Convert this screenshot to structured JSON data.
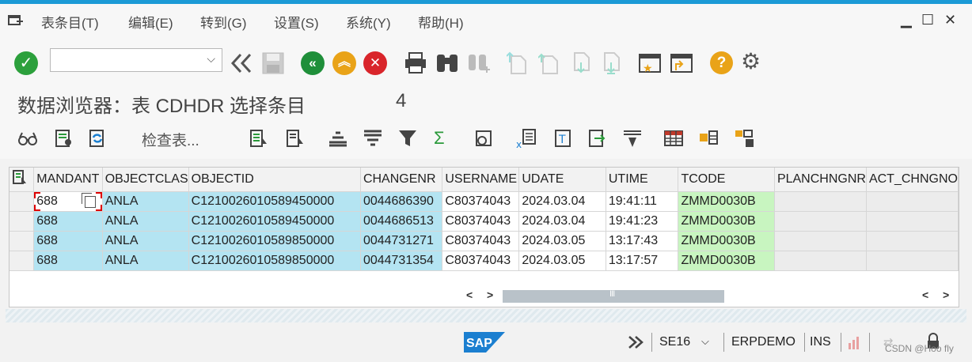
{
  "menubar": {
    "items": [
      "表条目(T)",
      "编辑(E)",
      "转到(G)",
      "设置(S)",
      "系统(Y)",
      "帮助(H)"
    ],
    "window_controls": [
      "▁",
      "☐",
      "✕"
    ]
  },
  "toolbar": {
    "command_field": {
      "value": "",
      "placeholder": ""
    },
    "icons": [
      "enter-icon",
      "back-double-icon",
      "save-icon",
      "back-icon",
      "exit-icon",
      "cancel-icon",
      "print-icon",
      "find-icon",
      "find-next-icon",
      "first-page-icon",
      "prev-page-icon",
      "next-page-icon",
      "last-page-icon",
      "create-session-icon",
      "shortcut-icon",
      "help-icon",
      "settings-icon"
    ]
  },
  "title": {
    "text": "数据浏览器：表 CDHDR 选择条目",
    "count": "4"
  },
  "apptoolbar": {
    "check_table": "检查表..."
  },
  "grid": {
    "columns": [
      "MANDANT",
      "OBJECTCLAS",
      "OBJECTID",
      "CHANGENR",
      "USERNAME",
      "UDATE",
      "UTIME",
      "TCODE",
      "PLANCHNGNR",
      "ACT_CHNGNO"
    ],
    "rows": [
      {
        "mandant": "688",
        "objectclas": "ANLA",
        "objectid": "C1210026010589450000",
        "changenr": "0044686390",
        "username": "C80374043",
        "udate": "2024.03.04",
        "utime": "19:41:11",
        "tcode": "ZMMD0030B"
      },
      {
        "mandant": "688",
        "objectclas": "ANLA",
        "objectid": "C1210026010589450000",
        "changenr": "0044686513",
        "username": "C80374043",
        "udate": "2024.03.04",
        "utime": "19:41:23",
        "tcode": "ZMMD0030B"
      },
      {
        "mandant": "688",
        "objectclas": "ANLA",
        "objectid": "C1210026010589850000",
        "changenr": "0044731271",
        "username": "C80374043",
        "udate": "2024.03.05",
        "utime": "13:17:43",
        "tcode": "ZMMD0030B"
      },
      {
        "mandant": "688",
        "objectclas": "ANLA",
        "objectid": "C1210026010589850000",
        "changenr": "0044731354",
        "username": "C80374043",
        "udate": "2024.03.05",
        "utime": "13:17:57",
        "tcode": "ZMMD0030B"
      }
    ],
    "scroll": {
      "left": "<",
      "right": ">",
      "grip": "III"
    }
  },
  "statusbar": {
    "transaction": "SE16",
    "system": "ERPDEMO",
    "mode": "INS",
    "logo": "SAP",
    "watermark": "CSDN @Hoo fly"
  },
  "colors": {
    "key_column": "#b4e4f2",
    "tcode_column": "#c8f5c0",
    "topbar": "#1b9ad6"
  }
}
